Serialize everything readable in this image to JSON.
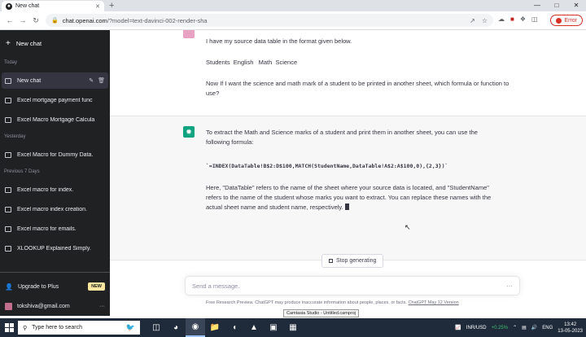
{
  "browser": {
    "tab_title": "New chat",
    "new_tab": "+",
    "url_host": "chat.openai.com",
    "url_rest": "/?model=text-davinci-002-render-sha",
    "profile_status": "Error",
    "win_controls": {
      "minimize": "—",
      "maximize": "□",
      "close": "✕"
    }
  },
  "sidebar": {
    "new_chat": "New chat",
    "sections": {
      "today": "Today",
      "yesterday": "Yesterday",
      "previous7": "Previous 7 Days"
    },
    "items": [
      {
        "label": "New chat"
      },
      {
        "label": "Excel mortgage payment func"
      },
      {
        "label": "Excel Macro Mortgage Calcula"
      },
      {
        "label": "Excel Macro for Dummy Data."
      },
      {
        "label": "Excel macro for index."
      },
      {
        "label": "Excel macro index creation."
      },
      {
        "label": "Excel macro for emails."
      },
      {
        "label": "XLOOKUP Explained Simply."
      }
    ],
    "upgrade": "Upgrade to Plus",
    "new_badge": "NEW",
    "user_email": "tokshiva@gmail.com"
  },
  "conversation": {
    "user_line1": "I have my source data table in the format given below.",
    "user_line2": "Students  English   Math  Science",
    "user_line3": "Now If I want the science and math mark of a student to be printed in another sheet, which formula or function to use?",
    "assistant_p1": "To extract the Math and Science marks of a student and print them in another sheet, you can use the following formula:",
    "assistant_code": "`=INDEX(DataTable!B$2:D$100,MATCH(StudentName,DataTable!A$2:A$100,0),{2,3})`",
    "assistant_p2": "Here, \"DataTable\" refers to the name of the sheet where your source data is located, and \"StudentName\" refers to the name of the student whose marks you want to extract. You can replace these names with the actual sheet name and student name, respectively."
  },
  "composer": {
    "stop_generating": "Stop generating",
    "placeholder": "Send a message.",
    "disclaimer": "Free Research Preview. ChatGPT may produce inaccurate information about people, places, or facts.",
    "version_link": "ChatGPT May 12 Version"
  },
  "camtasia_tooltip": "Camtasia Studio - Untitled.camproj",
  "taskbar": {
    "search_placeholder": "Type here to search",
    "currency": "INR/USD",
    "currency_change": "+0.25%",
    "lang": "ENG",
    "time": "13:42",
    "date": "13-05-2023"
  }
}
